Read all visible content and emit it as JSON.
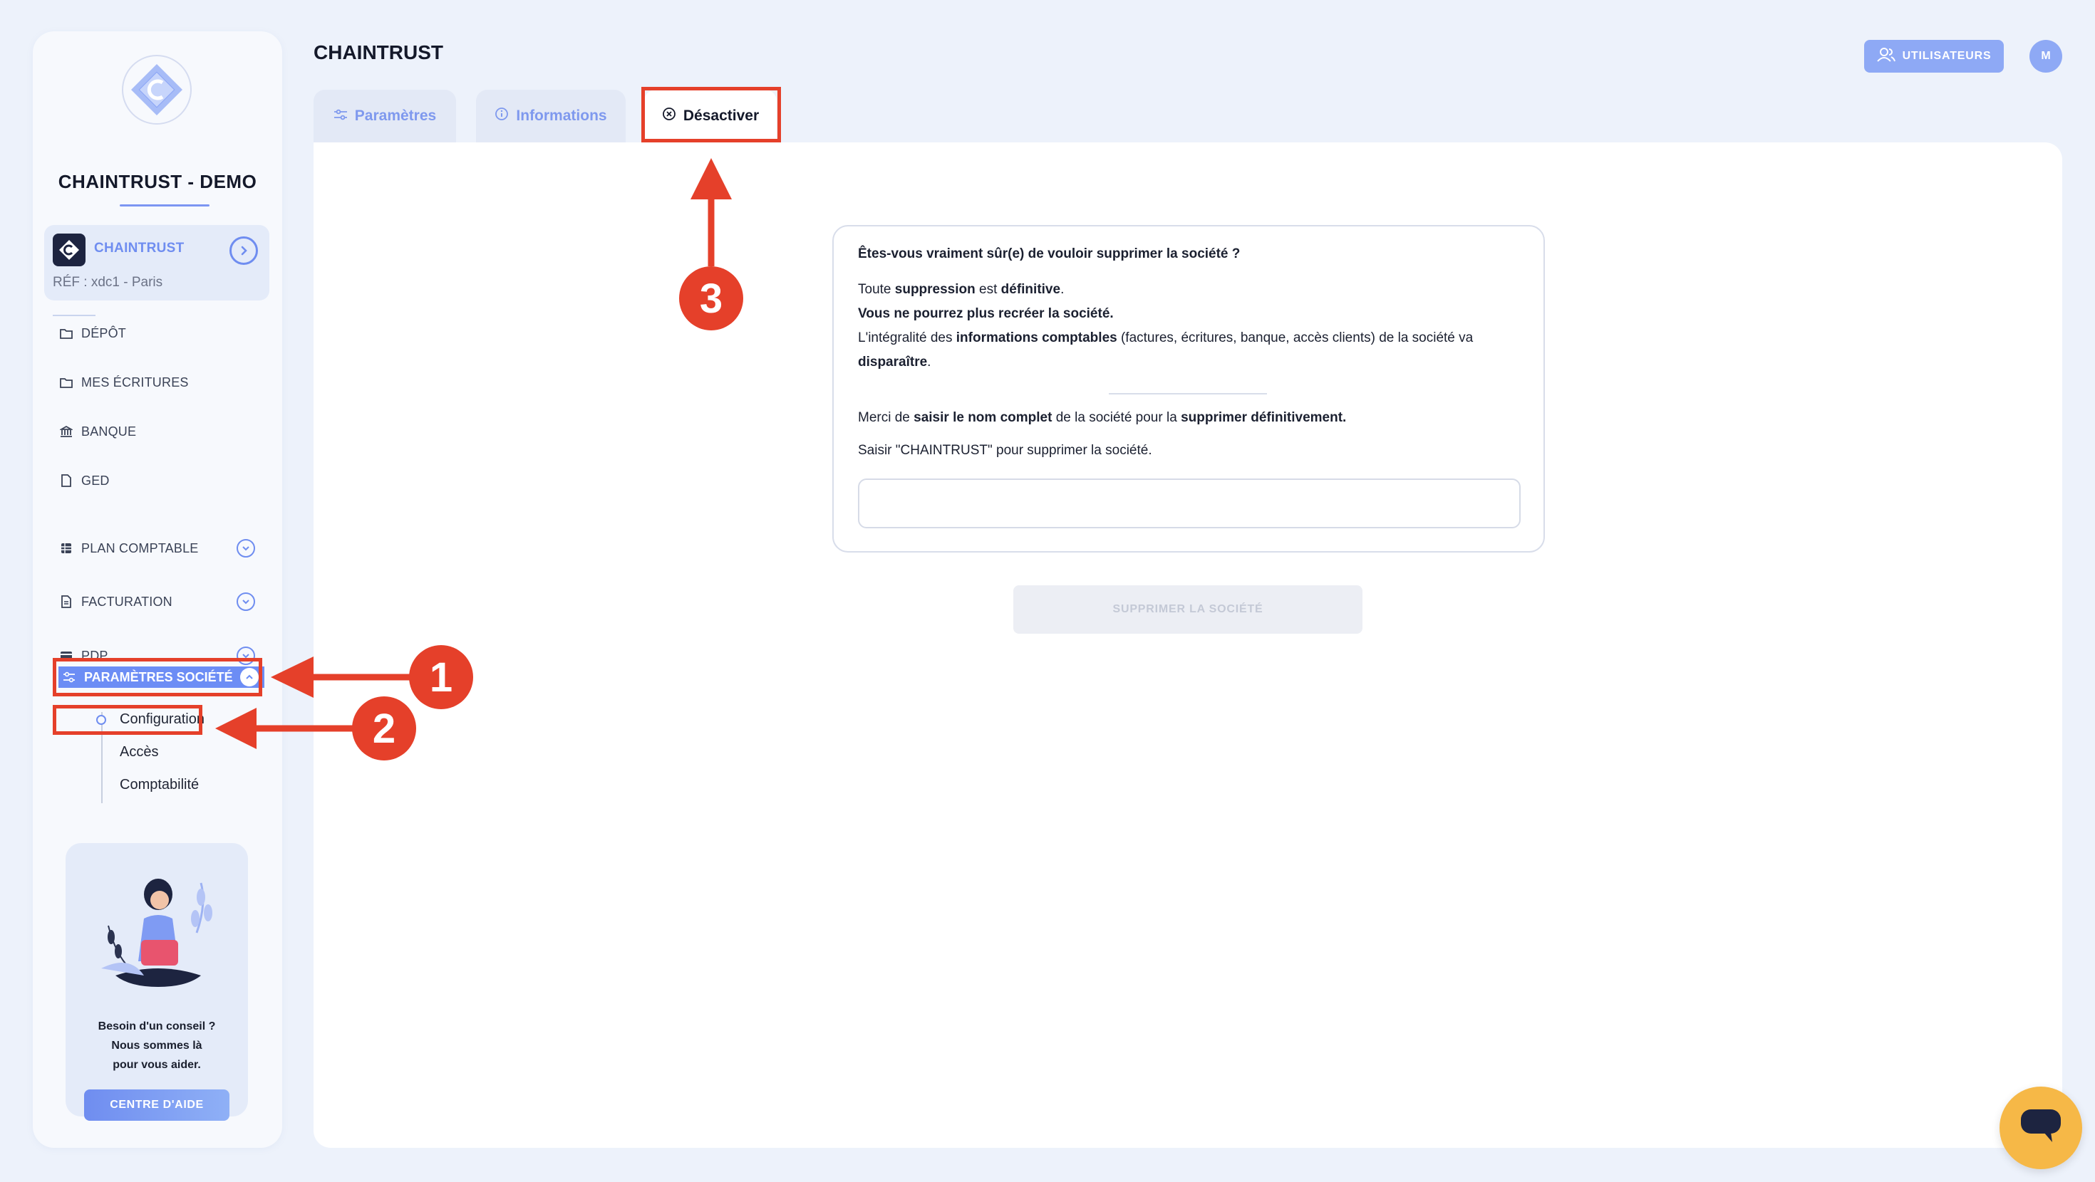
{
  "header": {
    "title": "CHAINTRUST",
    "users_label": "UTILISATEURS",
    "avatar_initial": "M"
  },
  "sidebar": {
    "company_title": "CHAINTRUST - DEMO",
    "company_card": {
      "name": "CHAINTRUST",
      "ref": "RÉF : xdc1 - Paris"
    },
    "items": [
      {
        "label": "DÉPÔT",
        "icon": "folder-icon"
      },
      {
        "label": "MES ÉCRITURES",
        "icon": "folder-icon"
      },
      {
        "label": "BANQUE",
        "icon": "bank-icon"
      },
      {
        "label": "GED",
        "icon": "document-icon"
      },
      {
        "label": "PLAN COMPTABLE",
        "icon": "table-icon"
      },
      {
        "label": "FACTURATION",
        "icon": "invoice-icon"
      },
      {
        "label": "PDP",
        "icon": "card-icon"
      }
    ],
    "active_section": {
      "label": "PARAMÈTRES SOCIÉTÉ",
      "subitems": [
        "Configuration",
        "Accès",
        "Comptabilité"
      ]
    },
    "help": {
      "line1": "Besoin d'un conseil ?",
      "line2": "Nous sommes là",
      "line3": "pour vous aider.",
      "button": "CENTRE D'AIDE"
    }
  },
  "tabs": [
    {
      "label": "Paramètres",
      "icon": "sliders-icon"
    },
    {
      "label": "Informations",
      "icon": "info-icon"
    },
    {
      "label": "Désactiver",
      "icon": "close-circle-icon",
      "active": true
    }
  ],
  "confirm": {
    "question": "Êtes-vous vraiment sûr(e) de vouloir supprimer la société ?",
    "l1a": "Toute ",
    "l1b": "suppression",
    "l1c": " est ",
    "l1d": "définitive",
    "l1e": ".",
    "l2": "Vous ne pourrez plus recréer la société.",
    "l3a": "L'intégralité des ",
    "l3b": "informations comptables",
    "l3c": " (factures, écritures, banque, accès clients) de la société va",
    "l4a": "disparaître",
    "l4b": ".",
    "l5a": "Merci de ",
    "l5b": "saisir le nom complet",
    "l5c": " de la société pour la ",
    "l5d": "supprimer définitivement.",
    "l6": "Saisir \"CHAINTRUST\" pour supprimer la société.",
    "input_value": "",
    "delete_button": "SUPPRIMER LA SOCIÉTÉ"
  },
  "annotations": {
    "n1": "1",
    "n2": "2",
    "n3": "3"
  },
  "colors": {
    "accent": "#6c8df5",
    "annotation": "#e5402a",
    "chat": "#f6b847"
  }
}
